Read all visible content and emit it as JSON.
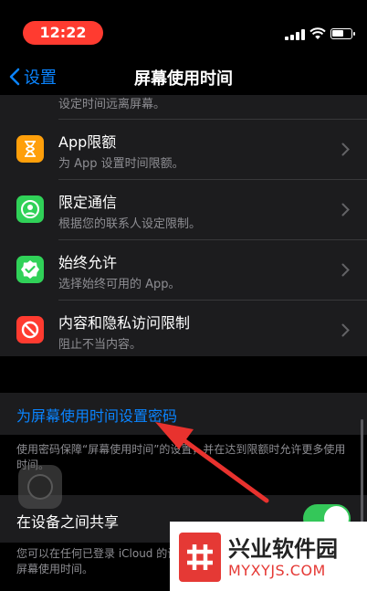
{
  "status_bar": {
    "time": "12:22"
  },
  "nav": {
    "back_label": "设置",
    "title": "屏幕使用时间"
  },
  "top_partial": {
    "subtitle": "设定时间远离屏幕。"
  },
  "rows": [
    {
      "title": "App限额",
      "subtitle": "为 App 设置时间限额。",
      "icon": "hourglass-icon",
      "color": "#ff9f0a"
    },
    {
      "title": "限定通信",
      "subtitle": "根据您的联系人设定限制。",
      "icon": "contact-icon",
      "color": "#30d158"
    },
    {
      "title": "始终允许",
      "subtitle": "选择始终可用的 App。",
      "icon": "check-badge-icon",
      "color": "#30d158"
    },
    {
      "title": "内容和隐私访问限制",
      "subtitle": "阻止不当内容。",
      "icon": "block-icon",
      "color": "#ff3b30"
    }
  ],
  "passcode": {
    "link_label": "为屏幕使用时间设置密码",
    "footer": "使用密码保障“屏幕使用时间”的设置，并在达到限额时允许更多使用时间。"
  },
  "share": {
    "label": "在设备之间共享",
    "toggle_on": true,
    "footer": "您可以在任何已登录 iCloud 的设备上启用此功能，以报告您的综合屏幕使用时间。"
  },
  "watermark": {
    "name": "兴业软件园",
    "url": "MYXYJS.COM"
  },
  "colors": {
    "accent": "#0a84ff",
    "toggle_on": "#34c759",
    "arrow": "#e8322e"
  }
}
